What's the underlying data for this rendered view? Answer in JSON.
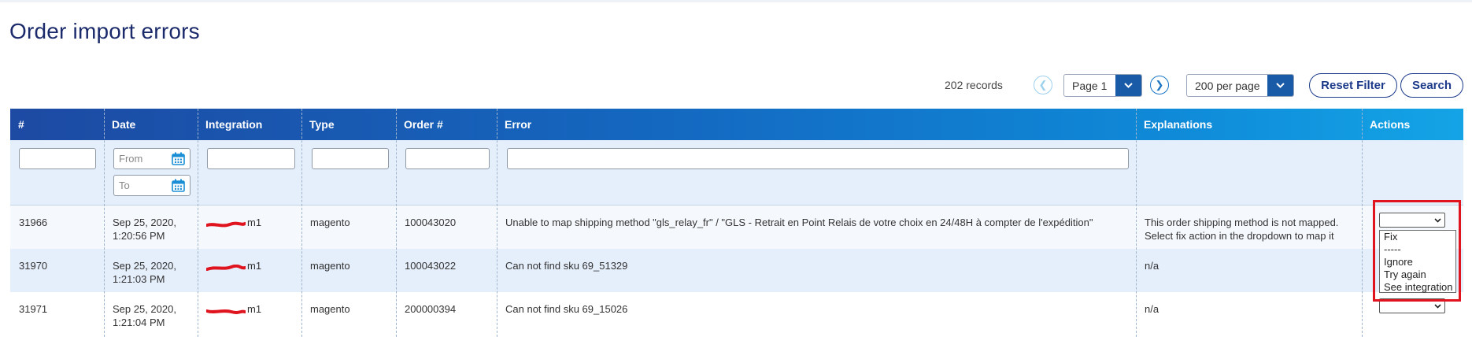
{
  "page": {
    "title": "Order import errors"
  },
  "toolbar": {
    "records": "202 records",
    "page_select": "Page 1",
    "per_page_select": "200 per page",
    "reset_filter": "Reset Filter",
    "search": "Search"
  },
  "columns": [
    "#",
    "Date",
    "Integration",
    "Type",
    "Order #",
    "Error",
    "Explanations",
    "Actions"
  ],
  "filters": {
    "date_from_placeholder": "From",
    "date_to_placeholder": "To"
  },
  "rows": [
    {
      "id": "31966",
      "date_line1": "Sep 25, 2020,",
      "date_line2": "1:20:56 PM",
      "integration": "m1",
      "type": "magento",
      "order": "100043020",
      "error": "Unable to map shipping method \"gls_relay_fr\" / \"GLS - Retrait en Point Relais de votre choix en 24/48H à compter de l'expédition\"",
      "explanation_line1": "This order shipping method is not mapped.",
      "explanation_line2": "Select fix action in the dropdown to map it"
    },
    {
      "id": "31970",
      "date_line1": "Sep 25, 2020,",
      "date_line2": "1:21:03 PM",
      "integration": "m1",
      "type": "magento",
      "order": "100043022",
      "error": "Can not find sku 69_51329",
      "explanation_line1": "n/a",
      "explanation_line2": ""
    },
    {
      "id": "31971",
      "date_line1": "Sep 25, 2020,",
      "date_line2": "1:21:04 PM",
      "integration": "m1",
      "type": "magento",
      "order": "200000394",
      "error": "Can not find sku 69_15026",
      "explanation_line1": "n/a",
      "explanation_line2": ""
    }
  ],
  "actions_dropdown": {
    "options": [
      "Fix",
      "-----",
      "Ignore",
      "Try again",
      "See integration"
    ]
  },
  "colors": {
    "accent": "#1a5ba8",
    "title": "#1b2a6b",
    "highlight": "#e0141e",
    "redaction": "#e0141e"
  }
}
